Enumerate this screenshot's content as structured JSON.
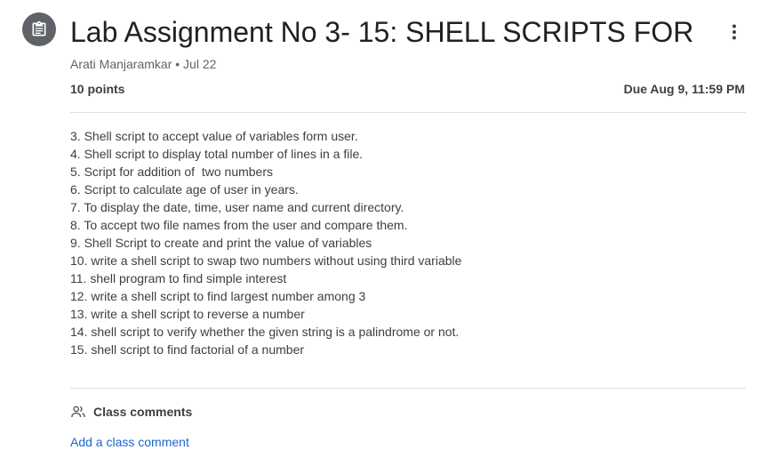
{
  "assignment": {
    "title": "Lab Assignment No 3- 15:  SHELL SCRIPTS FOR",
    "meta": "Arati Manjaramkar • Jul 22",
    "points": "10 points",
    "due": "Due Aug 9, 11:59 PM",
    "instructions": [
      "3. Shell script to accept value of variables form user.",
      "4. Shell script to display total number of lines in a file.",
      "5. Script for addition of  two numbers",
      "6. Script to calculate age of user in years.",
      "7. To display the date, time, user name and current directory.",
      "8. To accept two file names from the user and compare them.",
      "9. Shell Script to create and print the value of variables",
      "10. write a shell script to swap two numbers without using third variable",
      "11. shell program to find simple interest",
      "12. write a shell script to find largest number among 3",
      "13. write a shell script to reverse a number",
      "14. shell script to verify whether the given string is a palindrome or not.",
      "15. shell script to find factorial of a number"
    ]
  },
  "comments": {
    "header": "Class comments",
    "add_label": "Add a class comment"
  },
  "icons": {
    "assignment": "assignment-icon",
    "more": "more-vert-icon",
    "people": "people-icon"
  },
  "colors": {
    "icon_circle": "#5f6368",
    "title": "#202124",
    "text": "#3c4043",
    "meta": "#5f6368",
    "link": "#1967d2",
    "divider": "#e0e0e0"
  }
}
